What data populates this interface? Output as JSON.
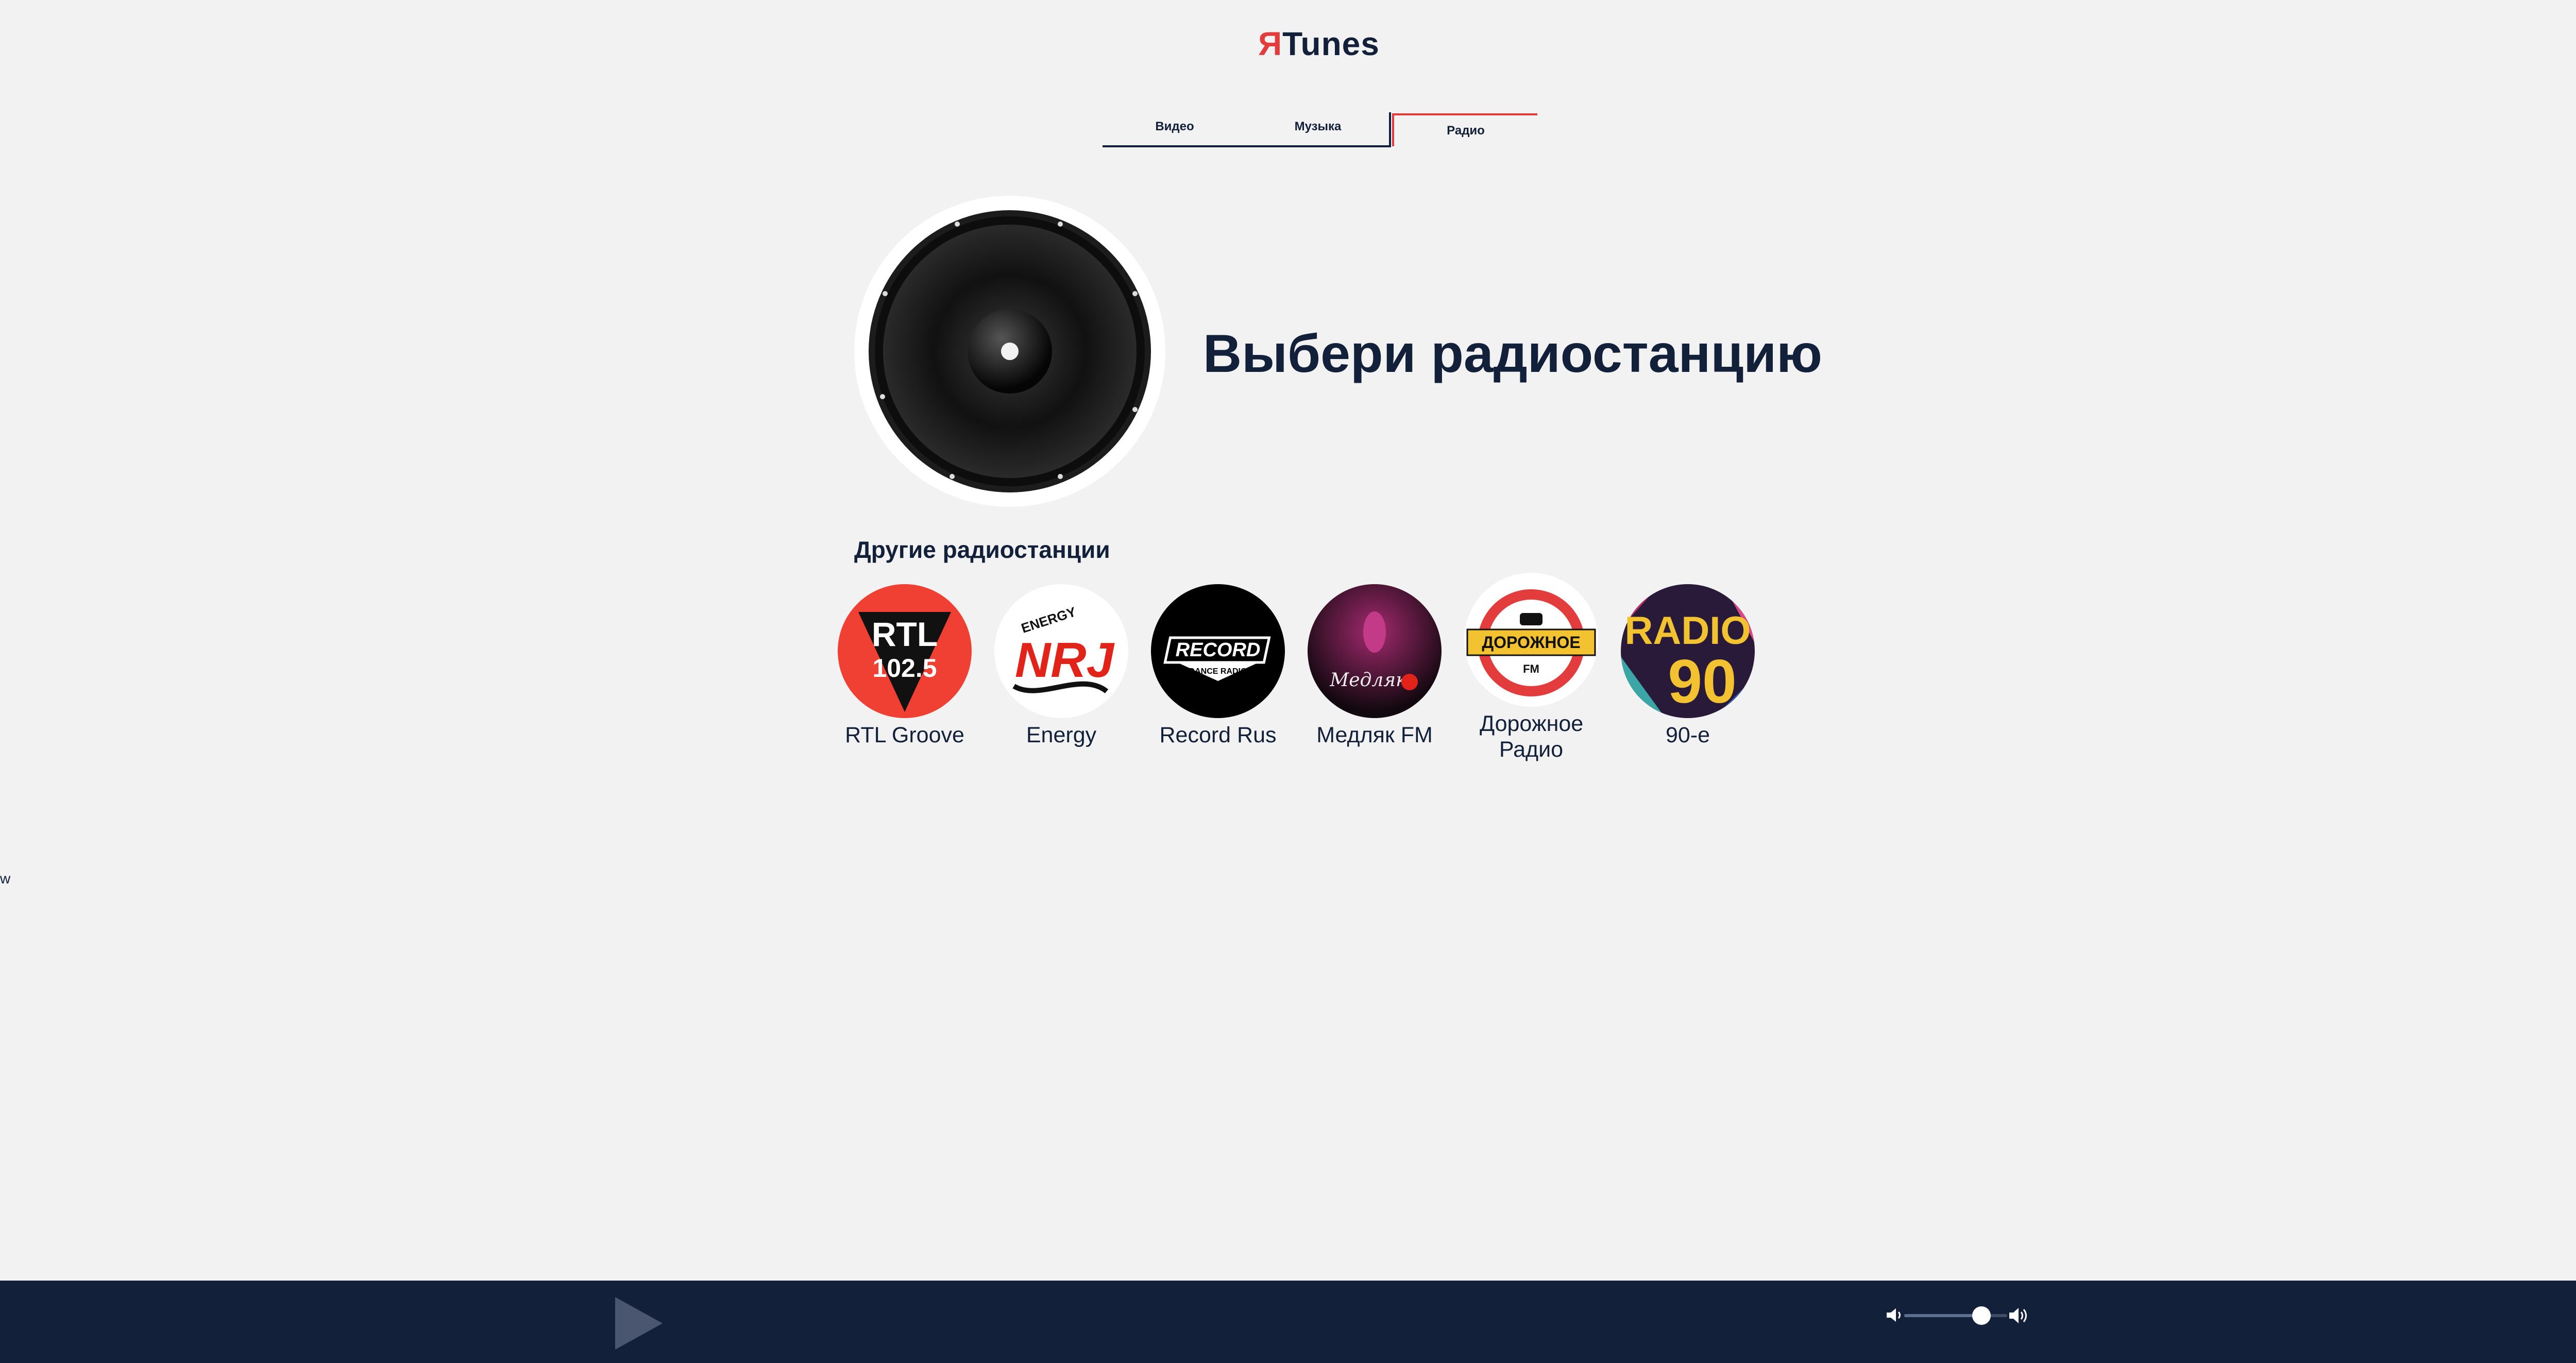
{
  "header": {
    "logo_mark": "Я",
    "logo_text": "Tunes"
  },
  "tabs": [
    {
      "label": "Видео",
      "active": false
    },
    {
      "label": "Музыка",
      "active": false
    },
    {
      "label": "Радио",
      "active": true
    }
  ],
  "hero": {
    "title": "Выбери радиостанцию"
  },
  "other": {
    "title": "Другие радиостанции",
    "stations": [
      {
        "name": "RTL Groove",
        "logo_text_1": "RTL",
        "logo_text_2": "102.5"
      },
      {
        "name": "Energy",
        "logo_text_1": "ENERGY",
        "logo_text_2": "NRJ"
      },
      {
        "name": "Record Rus",
        "logo_text_1": "RECORD",
        "logo_text_2": "DANCE RADIO"
      },
      {
        "name": "Медляк FM",
        "logo_text_1": "Медляк"
      },
      {
        "name": "Дорожное Радио",
        "logo_text_1": "ДОРОЖНОЕ",
        "logo_text_2": "FM"
      },
      {
        "name": "90-е",
        "logo_text_1": "RADIO",
        "logo_text_2": "90"
      }
    ]
  },
  "stray_text": "w",
  "player": {
    "volume": 0.75
  },
  "colors": {
    "accent": "#e23c3c",
    "navy": "#13203a",
    "background": "#f2f2f2"
  }
}
